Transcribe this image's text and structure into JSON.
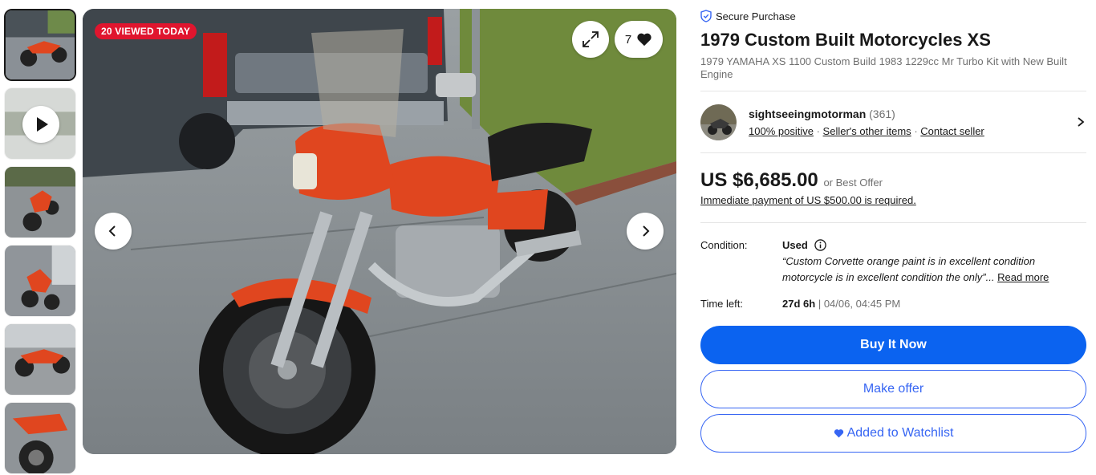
{
  "gallery": {
    "viewed_badge": "20 VIEWED TODAY",
    "watch_count": "7",
    "thumbnails": [
      {
        "kind": "image",
        "active": true
      },
      {
        "kind": "video"
      },
      {
        "kind": "image"
      },
      {
        "kind": "image"
      },
      {
        "kind": "image"
      },
      {
        "kind": "image"
      }
    ]
  },
  "listing": {
    "secure_label": "Secure Purchase",
    "title": "1979 Custom Built Motorcycles XS",
    "subtitle": "1979 YAMAHA XS 1100 Custom Build 1983 1229cc Mr Turbo Kit with New Built Engine"
  },
  "seller": {
    "name": "sightseeingmotorman",
    "feedback_count": "(361)",
    "positive": "100% positive",
    "other_items": "Seller's other items",
    "contact": "Contact seller"
  },
  "price": {
    "amount": "US $6,685.00",
    "best_offer": "or Best Offer",
    "payment_note": "Immediate payment of US $500.00 is required."
  },
  "condition": {
    "label": "Condition:",
    "value": "Used",
    "quote": "“Custom Corvette orange paint is in excellent condition motorcycle is in excellent condition the only”...",
    "read_more": "Read more"
  },
  "time_left": {
    "label": "Time left:",
    "remaining": "27d 6h",
    "separator": "|",
    "end": "04/06, 04:45 PM"
  },
  "actions": {
    "buy_now": "Buy It Now",
    "make_offer": "Make offer",
    "watchlist": "Added to Watchlist"
  },
  "colors": {
    "primary_blue": "#0b63f0",
    "outline_blue": "#3665f3",
    "badge_red": "#e0152e",
    "bike_orange": "#e0461f"
  }
}
